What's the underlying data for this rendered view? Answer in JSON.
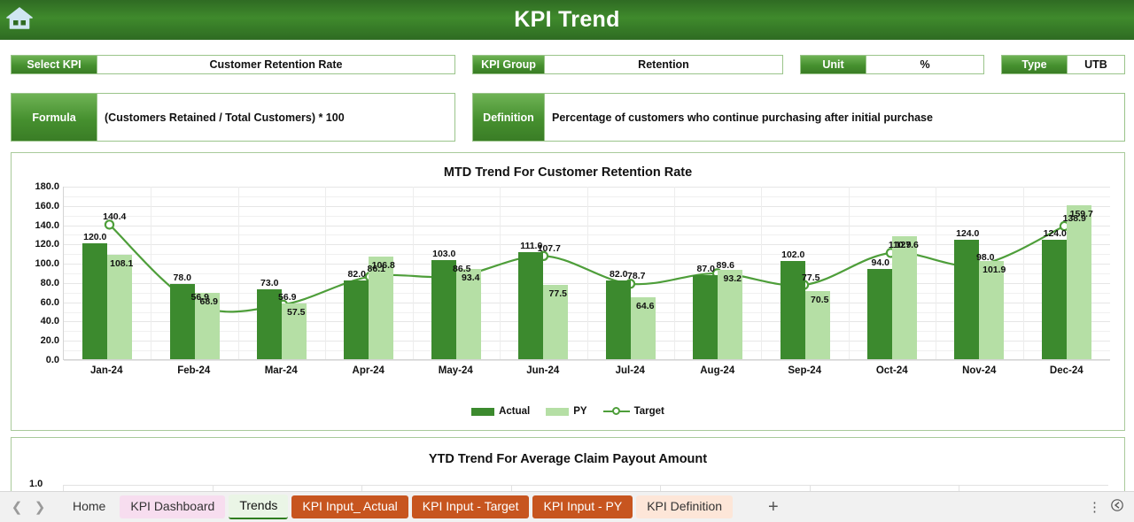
{
  "header": {
    "title": "KPI Trend",
    "home_icon": "home-icon"
  },
  "fields": {
    "select_kpi": {
      "label": "Select KPI",
      "value": "Customer Retention Rate"
    },
    "kpi_group": {
      "label": "KPI Group",
      "value": "Retention"
    },
    "unit": {
      "label": "Unit",
      "value": "%"
    },
    "type": {
      "label": "Type",
      "value": "UTB"
    },
    "formula": {
      "label": "Formula",
      "value": "(Customers Retained / Total Customers) * 100"
    },
    "definition": {
      "label": "Definition",
      "value": "Percentage of customers who continue purchasing after initial purchase"
    }
  },
  "chart_data": {
    "type": "bar",
    "title": "MTD Trend For Customer Retention Rate",
    "xlabel": "",
    "ylabel": "",
    "ylim": [
      0,
      180
    ],
    "yticks": [
      "0.0",
      "20.0",
      "40.0",
      "60.0",
      "80.0",
      "100.0",
      "120.0",
      "140.0",
      "160.0",
      "180.0"
    ],
    "grid": true,
    "legend_position": "bottom",
    "categories": [
      "Jan-24",
      "Feb-24",
      "Mar-24",
      "Apr-24",
      "May-24",
      "Jun-24",
      "Jul-24",
      "Aug-24",
      "Sep-24",
      "Oct-24",
      "Nov-24",
      "Dec-24"
    ],
    "series": [
      {
        "name": "Actual",
        "type": "bar",
        "color": "#3c8a2e",
        "values": [
          120.0,
          78.0,
          73.0,
          82.0,
          103.0,
          111.0,
          82.0,
          87.0,
          102.0,
          94.0,
          124.0,
          124.0
        ]
      },
      {
        "name": "PY",
        "type": "bar",
        "color": "#b5dfa5",
        "values": [
          108.1,
          68.9,
          57.5,
          106.8,
          93.4,
          77.5,
          64.6,
          93.2,
          70.5,
          127.6,
          101.9,
          159.7
        ]
      },
      {
        "name": "Target",
        "type": "line",
        "color": "#4e9e3a",
        "values": [
          140.4,
          56.9,
          56.9,
          86.1,
          86.5,
          107.7,
          78.7,
          89.6,
          77.5,
          110.9,
          98.0,
          138.9
        ]
      }
    ]
  },
  "chart2": {
    "title": "YTD Trend For Average Claim Payout Amount",
    "ytick_top": "1.0"
  },
  "tabbar": {
    "prev_icon": "chevron-left-icon",
    "next_icon": "chevron-right-icon",
    "add_label": "+",
    "kebab_label": "⋮",
    "tabs": [
      {
        "label": "Home",
        "style": "plain"
      },
      {
        "label": "KPI Dashboard",
        "style": "pink"
      },
      {
        "label": "Trends",
        "style": "active"
      },
      {
        "label": "KPI Input_ Actual",
        "style": "orange"
      },
      {
        "label": "KPI Input - Target",
        "style": "orange"
      },
      {
        "label": "KPI Input - PY",
        "style": "orange"
      },
      {
        "label": "KPI Definition",
        "style": "peach"
      }
    ]
  },
  "colors": {
    "brand_green": "#3f8a2c",
    "actual": "#3c8a2e",
    "py": "#b5dfa5",
    "target": "#4e9e3a",
    "orange_tab": "#c7551f"
  }
}
